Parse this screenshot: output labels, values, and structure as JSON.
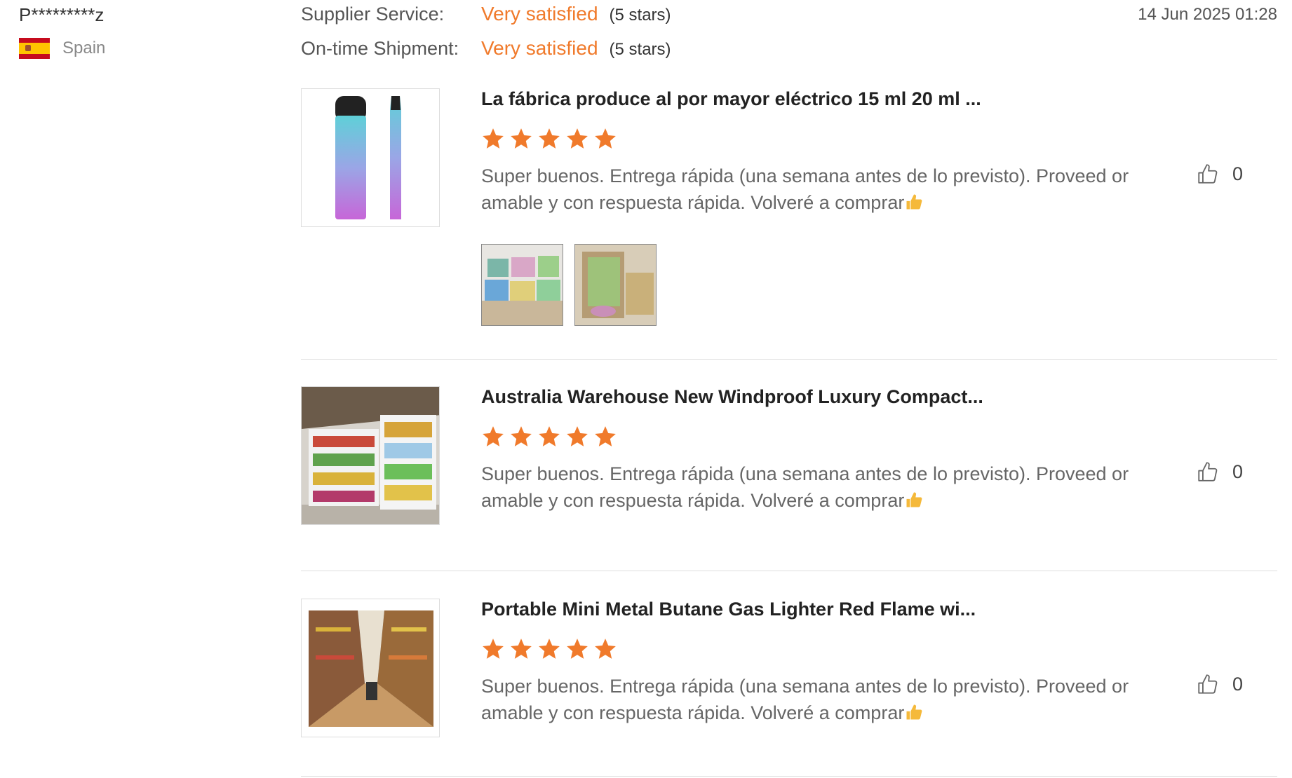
{
  "reviewer": {
    "name": "P*********z",
    "country": "Spain",
    "flag_icon": "spain-flag-icon"
  },
  "ratings": [
    {
      "label": "Supplier Service:",
      "value": "Very satisfied",
      "stars_text": "(5 stars)"
    },
    {
      "label": "On-time Shipment:",
      "value": "Very satisfied",
      "stars_text": "(5 stars)"
    }
  ],
  "date": "14 Jun 2025 01:28",
  "colors": {
    "accent": "#f07a2b",
    "text": "#333333",
    "muted": "#888888",
    "divider": "#dddddd"
  },
  "reviews": [
    {
      "product_title": "La fábrica produce al por mayor eléctrico 15 ml 20 ml ...",
      "star_count": 5,
      "text": "Super buenos. Entrega rápida (una semana antes de lo previsto). Proveed or amable y con respuesta rápida. Volveré a comprar",
      "likes": "0",
      "image_icon": "vape-pen-product-image",
      "attachments": [
        "boxes-photo",
        "boxes-in-carton-photo"
      ]
    },
    {
      "product_title": "Australia Warehouse New Windproof Luxury Compact...",
      "star_count": 5,
      "text": "Super buenos. Entrega rápida (una semana antes de lo previsto). Proveed or amable y con respuesta rápida. Volveré a comprar",
      "likes": "0",
      "image_icon": "store-shelves-product-image"
    },
    {
      "product_title": "Portable Mini Metal Butane Gas Lighter Red Flame wi...",
      "star_count": 5,
      "text": "Super buenos. Entrega rápida (una semana antes de lo previsto). Proveed or amable y con respuesta rápida. Volveré a comprar",
      "likes": "0",
      "image_icon": "supermarket-aisle-product-image"
    }
  ]
}
